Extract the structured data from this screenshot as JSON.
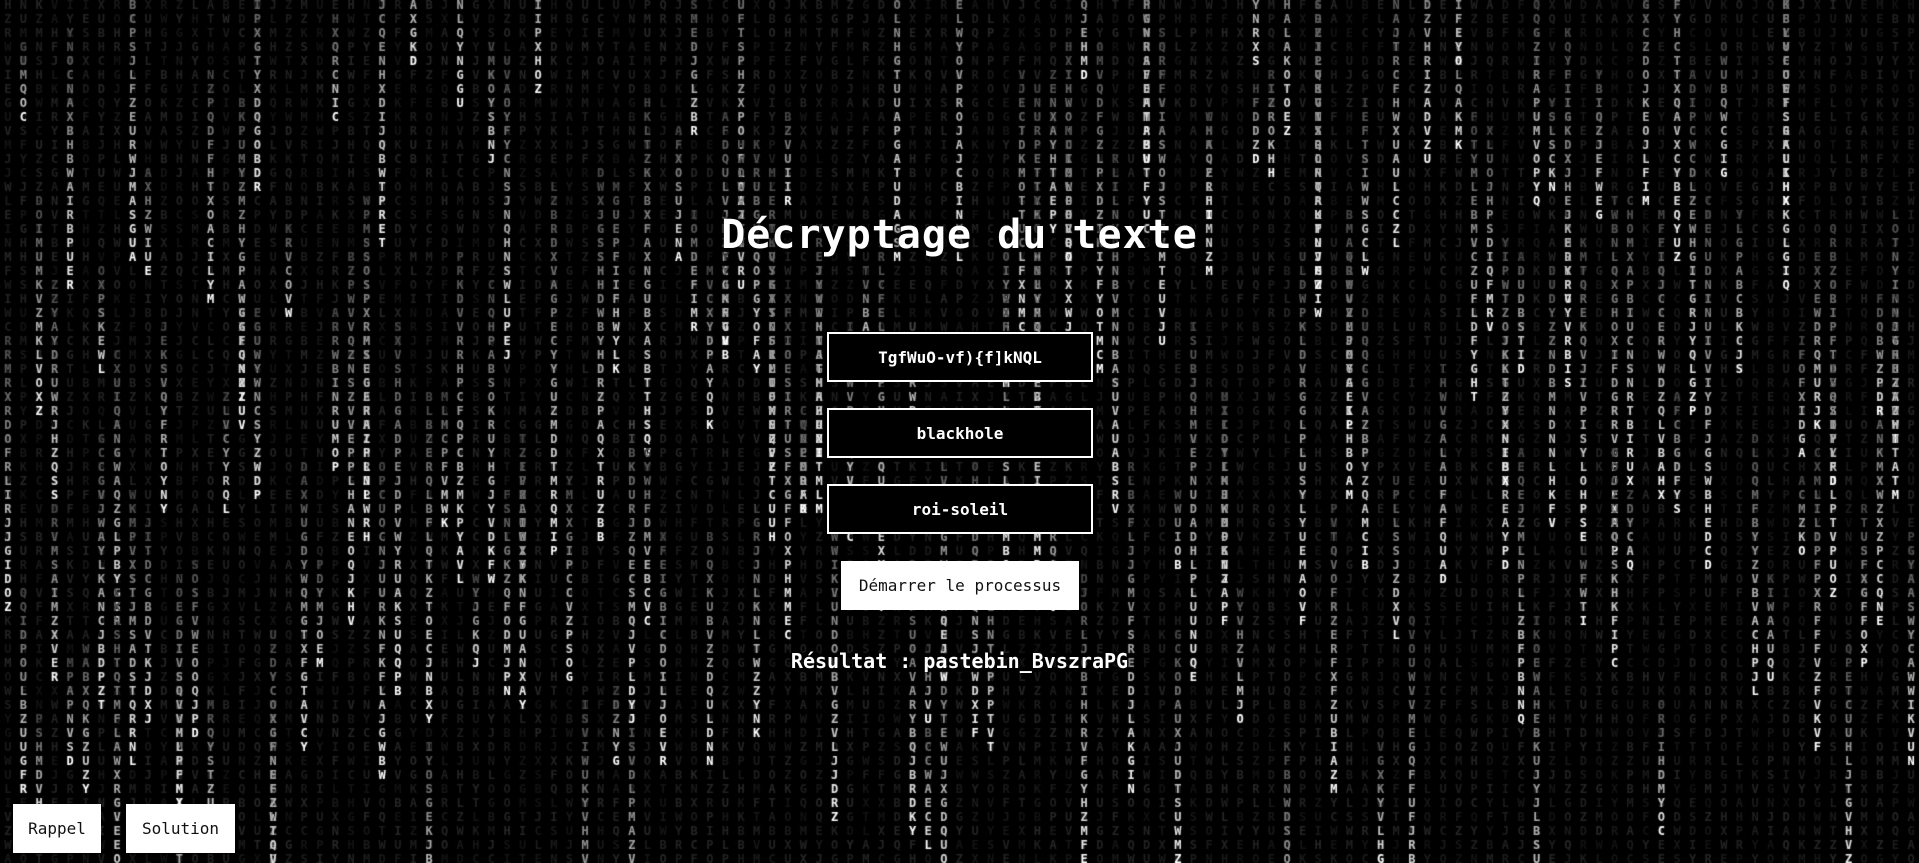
{
  "page": {
    "title": "Décryptage du texte"
  },
  "form": {
    "cipher_value": "TgfWuO-vf){f]kNQL",
    "key1_value": "blackhole",
    "key2_value": "roi-soleil",
    "start_label": "Démarrer le processus"
  },
  "result": {
    "text": "Résultat : pastebin_BvszraPG"
  },
  "footer": {
    "rappel_label": "Rappel",
    "solution_label": "Solution"
  },
  "theme": {
    "background": "#000000",
    "rain_bright": "#ffffff",
    "rain_dim": "#2a2a2a",
    "text": "#ffffff"
  }
}
